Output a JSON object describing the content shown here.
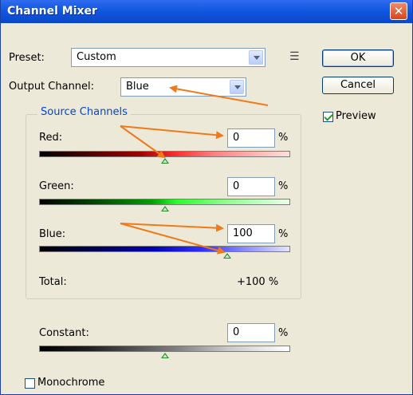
{
  "window": {
    "title": "Channel Mixer",
    "close_glyph": "✕"
  },
  "preset": {
    "label": "Preset:",
    "value": "Custom"
  },
  "output_channel": {
    "label": "Output Channel:",
    "value": "Blue"
  },
  "buttons": {
    "ok": "OK",
    "cancel": "Cancel"
  },
  "preview": {
    "label": "Preview",
    "checked": true
  },
  "source_channels": {
    "title": "Source Channels",
    "red": {
      "label": "Red:",
      "value": "0",
      "unit": "%",
      "slider_level": 0.5
    },
    "green": {
      "label": "Green:",
      "value": "0",
      "unit": "%",
      "slider_level": 0.5
    },
    "blue": {
      "label": "Blue:",
      "value": "100",
      "unit": "%",
      "slider_level": 0.75
    },
    "total": {
      "label": "Total:",
      "value": "+100 %"
    }
  },
  "constant": {
    "label": "Constant:",
    "value": "0",
    "unit": "%",
    "slider_level": 0.5
  },
  "monochrome": {
    "label": "Monochrome",
    "checked": false
  },
  "icons": {
    "settings_menu": "settings-menu-icon",
    "arrow_color": "#f07a1a"
  }
}
